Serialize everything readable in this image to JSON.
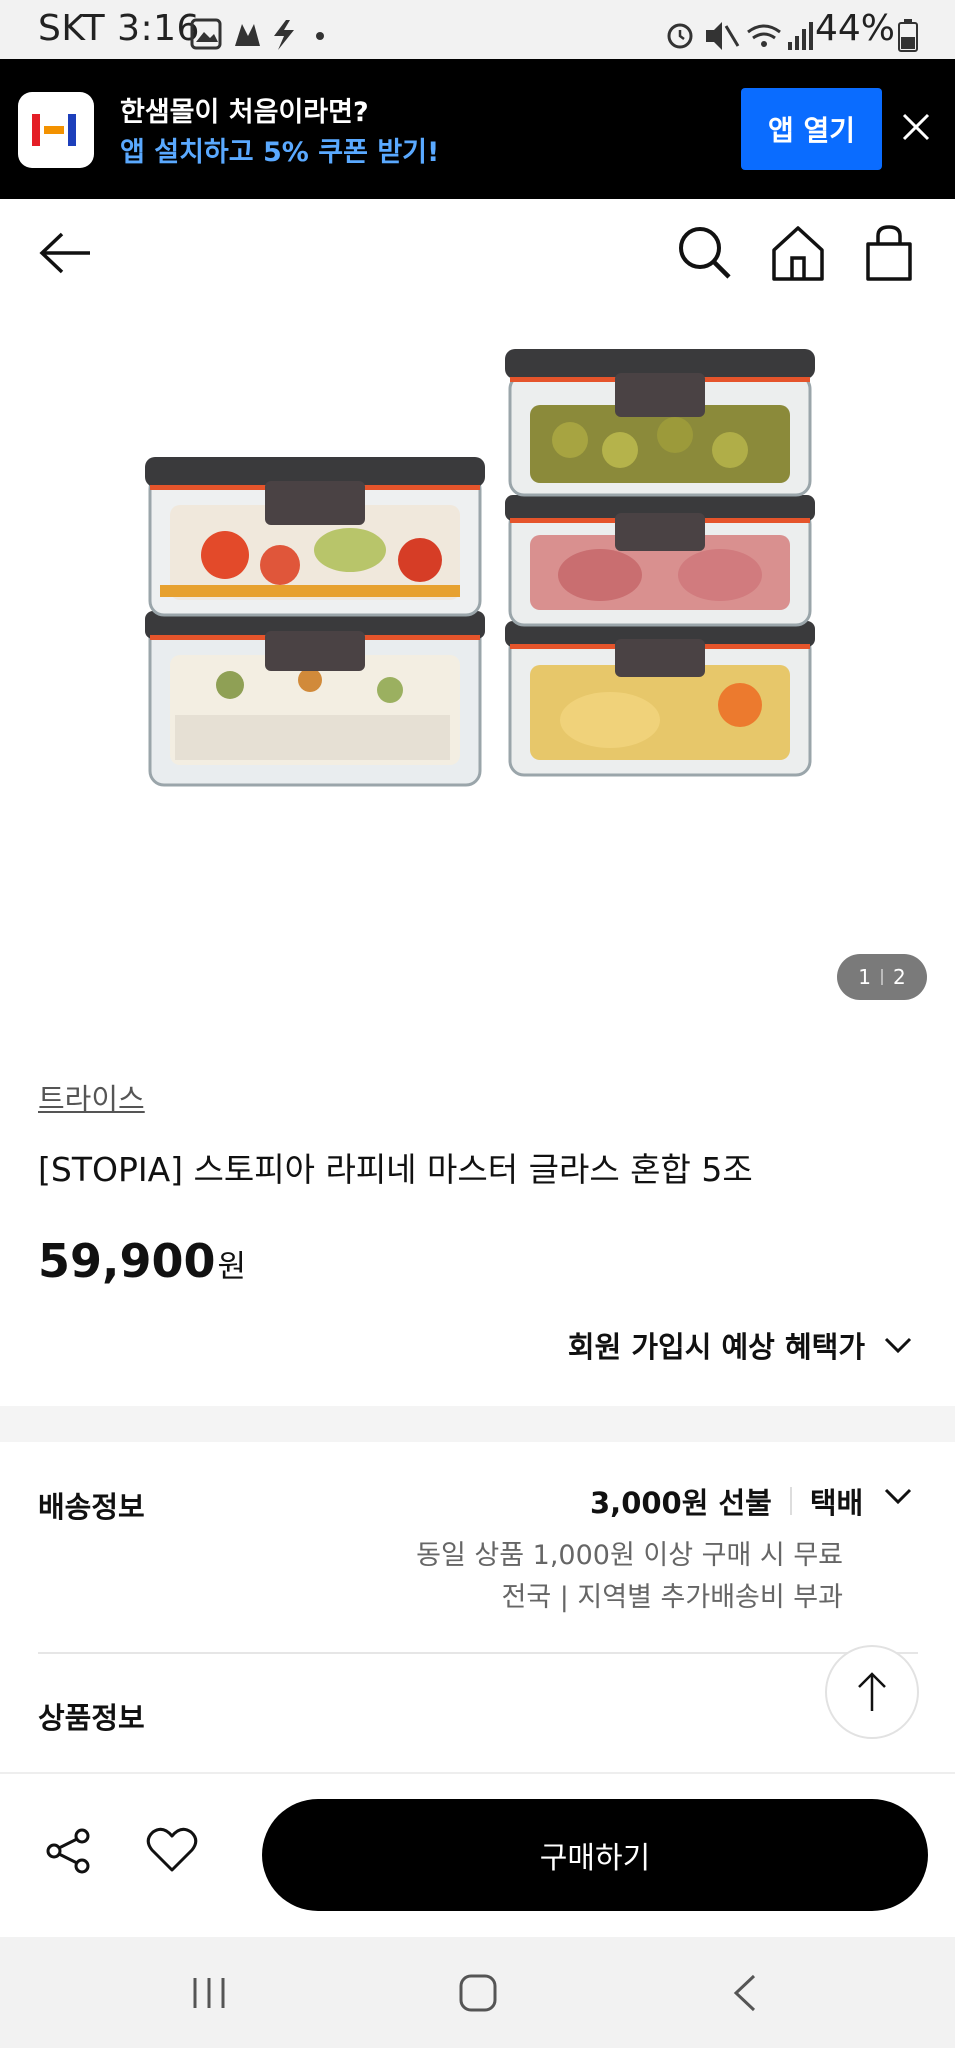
{
  "status_bar": {
    "time": "SKT 3:16",
    "battery": "44%"
  },
  "app_banner": {
    "line1": "한샘몰이 처음이라면?",
    "line2": "앱 설치하고 5% 쿠폰 받기!",
    "open_button": "앱 열기"
  },
  "product": {
    "image_counter": {
      "current": "1",
      "total": "2"
    },
    "brand": "트라이스",
    "title": "[STOPIA] 스토피아 라피네 마스터 글라스 혼합 5조",
    "price": "59,900",
    "price_unit": "원",
    "benefit_toggle": "회원 가입시 예상 혜택가"
  },
  "shipping": {
    "label": "배송정보",
    "fee": "3,000원 선불",
    "method": "택배",
    "note1": "동일 상품 1,000원 이상 구매 시 무료",
    "note2": "전국 | 지역별 추가배송비 부과"
  },
  "product_info_label": "상품정보",
  "bottom_bar": {
    "buy_button": "구매하기"
  },
  "icons": [
    "back-arrow-icon",
    "search-icon",
    "home-icon",
    "shopping-bag-icon",
    "share-icon",
    "heart-icon",
    "arrow-up-icon",
    "close-icon",
    "chevron-down-icon"
  ]
}
